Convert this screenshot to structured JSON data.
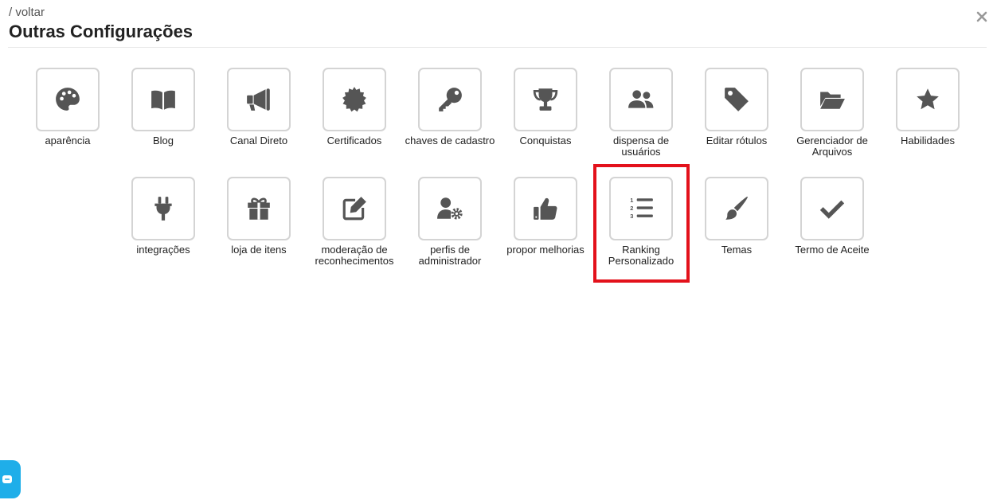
{
  "header": {
    "back_label": "/ voltar",
    "title": "Outras Configurações"
  },
  "tiles_row1": [
    {
      "label": "aparência",
      "icon": "palette-icon"
    },
    {
      "label": "Blog",
      "icon": "book-icon"
    },
    {
      "label": "Canal Direto",
      "icon": "megaphone-icon"
    },
    {
      "label": "Certificados",
      "icon": "certificate-icon"
    },
    {
      "label": "chaves de cadastro",
      "icon": "key-icon"
    },
    {
      "label": "Conquistas",
      "icon": "trophy-icon"
    },
    {
      "label": "dispensa de usuários",
      "icon": "users-icon"
    },
    {
      "label": "Editar rótulos",
      "icon": "tag-icon"
    },
    {
      "label": "Gerenciador de Arquivos",
      "icon": "folder-open-icon"
    },
    {
      "label": "Habilidades",
      "icon": "star-icon"
    }
  ],
  "tiles_row2": [
    {
      "label": "integrações",
      "icon": "plug-icon"
    },
    {
      "label": "loja de itens",
      "icon": "gift-icon"
    },
    {
      "label": "moderação de reconhecimentos",
      "icon": "edit-icon"
    },
    {
      "label": "perfis de administrador",
      "icon": "user-cog-icon"
    },
    {
      "label": "propor melhorias",
      "icon": "thumbs-up-icon"
    },
    {
      "label": "Ranking Personalizado",
      "icon": "list-ol-icon"
    },
    {
      "label": "Temas",
      "icon": "paint-brush-icon"
    },
    {
      "label": "Termo de Aceite",
      "icon": "check-icon"
    }
  ],
  "colors": {
    "icon": "#555555",
    "tile_border": "#d4d4d4",
    "highlight": "#e3111b",
    "chat_bubble": "#1faee9"
  }
}
